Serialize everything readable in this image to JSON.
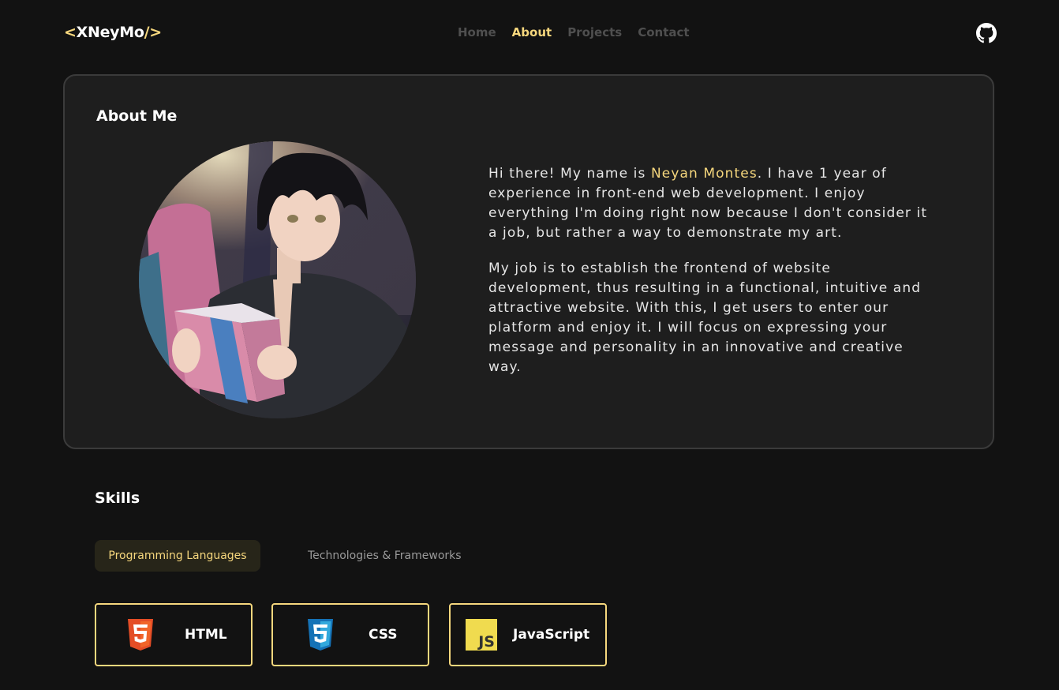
{
  "header": {
    "logo": {
      "open": "<",
      "name": "XNeyMo",
      "close": "/>"
    },
    "nav": [
      {
        "label": "Home",
        "active": false
      },
      {
        "label": "About",
        "active": true
      },
      {
        "label": "Projects",
        "active": false
      },
      {
        "label": "Contact",
        "active": false
      }
    ],
    "github_icon": "github-icon"
  },
  "about": {
    "title": "About Me",
    "avatar_image": "anime-boy-reading-book",
    "paragraph1_pre": "Hi there! My name is ",
    "name": "Neyan Montes",
    "paragraph1_post": ". I have 1 year of experience in front-end web development. I enjoy everything I'm doing right now because I don't consider it a job, but rather a way to demonstrate my art.",
    "paragraph2": "My job is to establish the frontend of website development, thus resulting in a functional, intuitive and attractive website. With this, I get users to enter our platform and enjoy it. I will focus on expressing your message and personality in an innovative and creative way."
  },
  "skills": {
    "title": "Skills",
    "tabs": [
      {
        "label": "Programming Languages",
        "active": true
      },
      {
        "label": "Technologies & Frameworks",
        "active": false
      }
    ],
    "items": [
      {
        "label": "HTML",
        "icon": "html5-icon"
      },
      {
        "label": "CSS",
        "icon": "css3-icon"
      },
      {
        "label": "JavaScript",
        "icon": "javascript-icon"
      }
    ]
  },
  "colors": {
    "accent": "#f6d77d",
    "background": "#121212",
    "card": "#1e1e1e",
    "html": "#e44d26",
    "css": "#1572b6",
    "js": "#f0db4f"
  }
}
